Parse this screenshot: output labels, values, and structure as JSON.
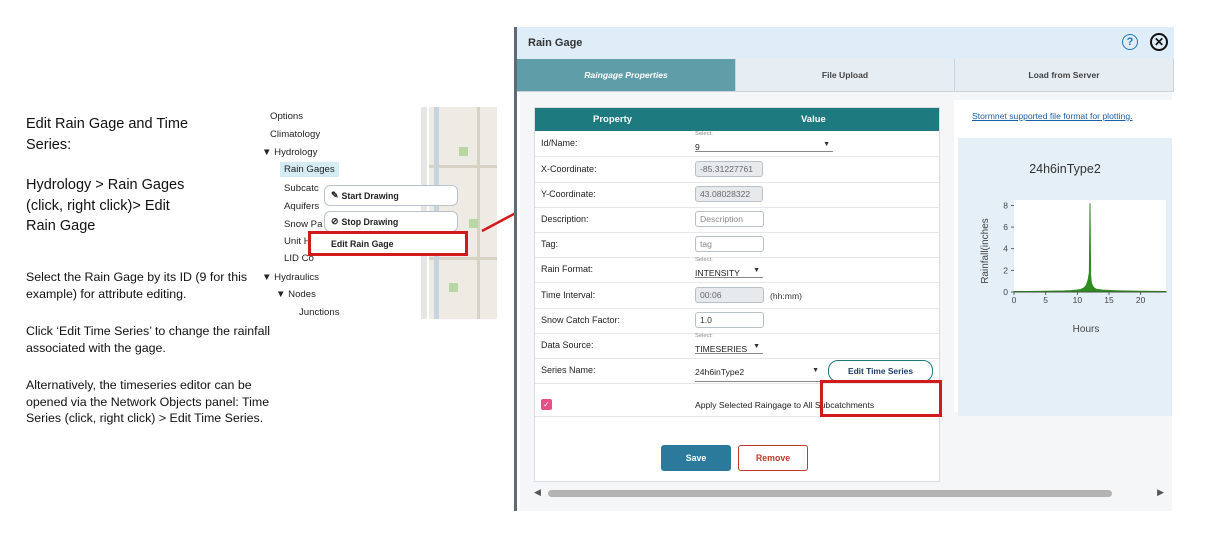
{
  "instructions": {
    "title_line1": "Edit Rain Gage and Time",
    "title_line2": "Series:",
    "path_line1": "Hydrology > Rain Gages",
    "path_line2": "(click, right click)> Edit",
    "path_line3": "Rain Gage",
    "note1": "Select the Rain Gage by its ID (9 for this example) for attribute editing.",
    "note2": "Click ‘Edit Time Series’ to change the rainfall associated with the gage.",
    "note3": "Alternatively, the timeseries editor can be opened via the Network Objects panel: Time Series (click, right click) > Edit Time Series."
  },
  "tree": {
    "items": [
      "Options",
      "Climatology",
      "Hydrology",
      "Rain Gages",
      "Subcatc",
      "Aquifers",
      "Snow Pa",
      "Unit H",
      "LID Co",
      "Hydraulics",
      "Nodes",
      "Junctions"
    ],
    "context_menu": {
      "start_drawing": "Start Drawing",
      "stop_drawing": "Stop Drawing",
      "edit_rain_gage": "Edit Rain Gage"
    }
  },
  "dialog": {
    "title": "Rain Gage",
    "tabs": [
      "Raingage Properties",
      "File Upload",
      "Load from Server"
    ],
    "active_tab": "Raingage Properties",
    "table_headers": {
      "property": "Property",
      "value": "Value"
    },
    "select_caption": "Select:",
    "properties": {
      "id_name": {
        "label": "Id/Name:",
        "value": "9"
      },
      "x_coord": {
        "label": "X-Coordinate:",
        "value": "-85.31227761"
      },
      "y_coord": {
        "label": "Y-Coordinate:",
        "value": "43.08028322"
      },
      "description": {
        "label": "Description:",
        "placeholder": "Description"
      },
      "tag": {
        "label": "Tag:",
        "placeholder": "tag"
      },
      "rain_format": {
        "label": "Rain Format:",
        "value": "INTENSITY"
      },
      "time_interval": {
        "label": "Time Interval:",
        "value": "00:06",
        "unit": "(hh:mm)"
      },
      "snow_catch": {
        "label": "Snow Catch Factor:",
        "value": "1.0"
      },
      "data_source": {
        "label": "Data Source:",
        "value": "TIMESERIES"
      },
      "series_name": {
        "label": "Series Name:",
        "value": "24h6inType2"
      }
    },
    "edit_time_series_label": "Edit Time Series",
    "apply_all_label": "Apply Selected Raingage to All Subcatchments",
    "apply_all_checked": true,
    "save_label": "Save",
    "remove_label": "Remove",
    "chart_link": "Stormnet supported file format for plotting."
  },
  "chart_data": {
    "type": "area",
    "title": "24h6inType2",
    "xlabel": "Hours",
    "ylabel": "Rainfall(inches",
    "xlim": [
      0,
      24
    ],
    "ylim": [
      0,
      8.5
    ],
    "xticks": [
      0,
      5,
      10,
      15,
      20
    ],
    "yticks": [
      0,
      2,
      4,
      6,
      8
    ],
    "color": "#2e8b1f",
    "x": [
      0,
      2,
      4,
      6,
      8,
      9,
      10,
      10.5,
      11,
      11.4,
      11.7,
      11.9,
      12.0,
      12.1,
      12.2,
      12.4,
      12.7,
      13,
      14,
      16,
      18,
      20,
      22,
      24
    ],
    "y": [
      0.04,
      0.05,
      0.06,
      0.08,
      0.1,
      0.13,
      0.18,
      0.23,
      0.35,
      0.6,
      1.1,
      1.8,
      8.2,
      1.6,
      0.9,
      0.55,
      0.35,
      0.26,
      0.17,
      0.12,
      0.09,
      0.07,
      0.06,
      0.05
    ]
  }
}
